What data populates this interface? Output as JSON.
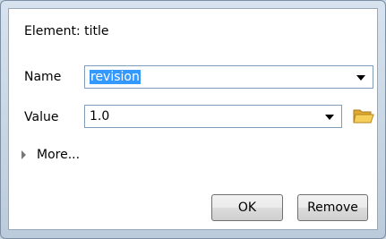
{
  "dialog": {
    "heading": "Element: title",
    "name_label": "Name",
    "name_value": "revision",
    "value_label": "Value",
    "value_value": "1.0",
    "more_label": "More...",
    "ok_label": "OK",
    "remove_label": "Remove"
  },
  "icons": {
    "name_dropdown": "chevron-down-icon",
    "value_dropdown": "chevron-down-icon",
    "browse": "folder-open-icon",
    "expand": "triangle-right-icon"
  },
  "colors": {
    "selection": "#3399ff",
    "folder": "#f3c44b"
  }
}
